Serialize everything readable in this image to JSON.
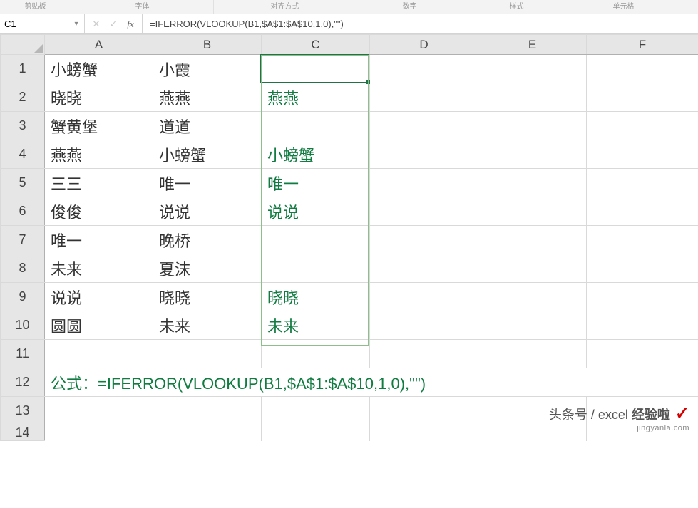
{
  "ribbon": {
    "groups": [
      "剪贴板",
      "字体",
      "对齐方式",
      "数字",
      "样式",
      "单元格"
    ]
  },
  "nameBox": {
    "value": "C1"
  },
  "formulaBar": {
    "value": "=IFERROR(VLOOKUP(B1,$A$1:$A$10,1,0),\"\")"
  },
  "columns": [
    "A",
    "B",
    "C",
    "D",
    "E",
    "F"
  ],
  "rows": [
    "1",
    "2",
    "3",
    "4",
    "5",
    "6",
    "7",
    "8",
    "9",
    "10",
    "11",
    "12",
    "13",
    "14"
  ],
  "cells": {
    "A1": "小螃蟹",
    "B1": "小霞",
    "C1": "",
    "A2": "晓晓",
    "B2": "燕燕",
    "C2": "燕燕",
    "A3": "蟹黄堡",
    "B3": "道道",
    "C3": "",
    "A4": "燕燕",
    "B4": "小螃蟹",
    "C4": "小螃蟹",
    "A5": "三三",
    "B5": "唯一",
    "C5": "唯一",
    "A6": "俊俊",
    "B6": "说说",
    "C6": "说说",
    "A7": "唯一",
    "B7": "晚桥",
    "C7": "",
    "A8": "未来",
    "B8": "夏沫",
    "C8": "",
    "A9": "说说",
    "B9": "晓晓",
    "C9": "晓晓",
    "A10": "圆圆",
    "B10": "未来",
    "C10": "未来"
  },
  "formulaRow": {
    "text": "公式：=IFERROR(VLOOKUP(B1,$A$1:$A$10,1,0),\"\")"
  },
  "watermark": {
    "line1": "经验啦",
    "line2": "头条号 / excel",
    "domain": "jingyanla.com"
  },
  "selection": {
    "cell": "C1"
  }
}
